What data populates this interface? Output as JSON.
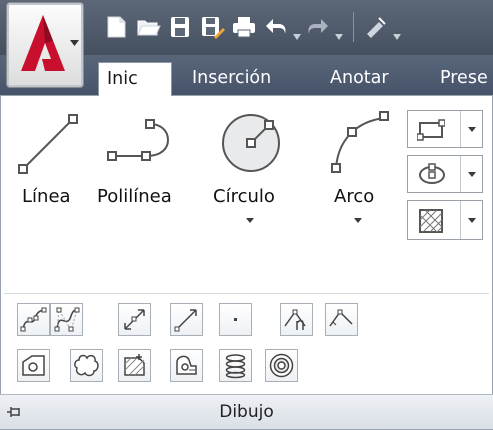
{
  "ribbon": {
    "tabs": [
      {
        "label": "Inic",
        "active": true
      },
      {
        "label": "Inserción",
        "active": false
      },
      {
        "label": "Anotar",
        "active": false
      },
      {
        "label": "Prese",
        "active": false
      }
    ]
  },
  "quick_access": {
    "icons": [
      "new-icon",
      "open-icon",
      "save-icon",
      "save-as-icon",
      "print-icon",
      "undo-icon",
      "redo-icon"
    ]
  },
  "draw_panel": {
    "tools": [
      {
        "label": "Línea",
        "icon": "line-icon"
      },
      {
        "label": "Polilínea",
        "icon": "polyline-icon"
      },
      {
        "label": "Círculo",
        "icon": "circle-icon"
      },
      {
        "label": "Arco",
        "icon": "arc-icon"
      }
    ],
    "title": "Dibujo"
  },
  "colors": {
    "title_bar": "#4e5a6b",
    "accent_red": "#c8102e",
    "panel_bg": "#ffffff"
  }
}
